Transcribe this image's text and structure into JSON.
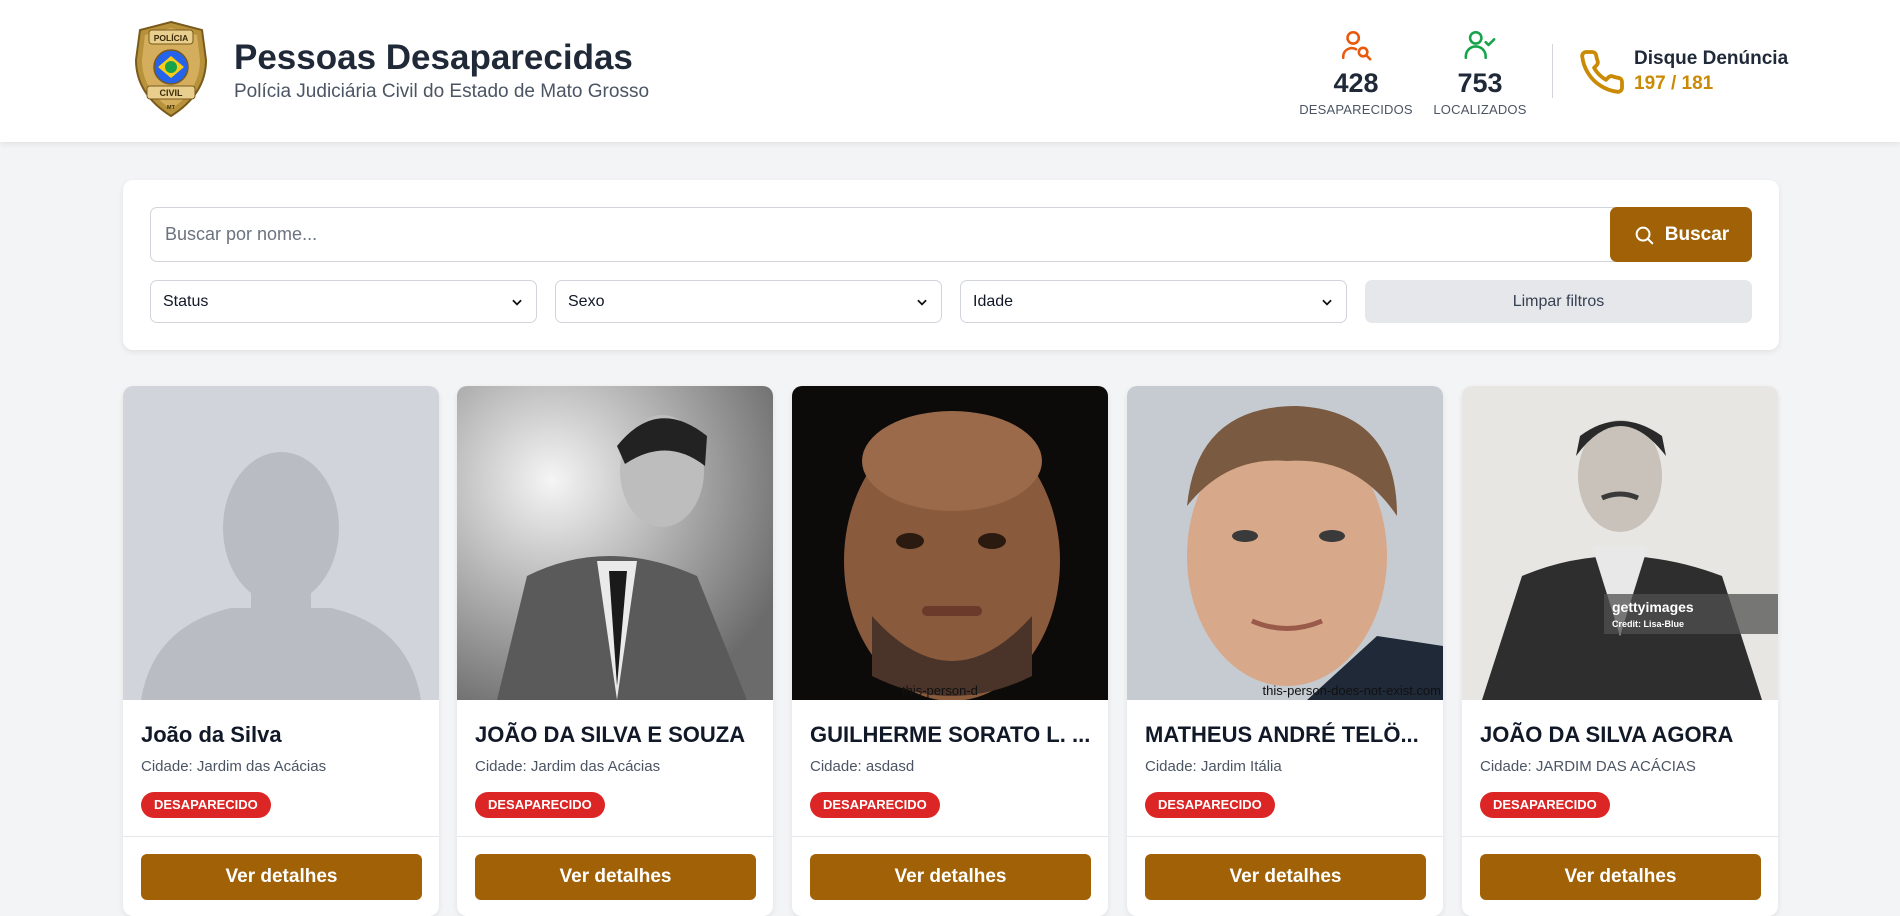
{
  "header": {
    "title": "Pessoas Desaparecidas",
    "subtitle": "Polícia Judiciária Civil do Estado de Mato Grosso",
    "logo": {
      "top_text": "POLÍCIA",
      "bottom_text": "CIVIL",
      "state": "MT"
    },
    "stats": [
      {
        "value": "428",
        "label": "DESAPARECIDOS",
        "icon": "user-search-icon",
        "color": "#ea580c"
      },
      {
        "value": "753",
        "label": "LOCALIZADOS",
        "icon": "user-check-icon",
        "color": "#16a34a"
      }
    ],
    "hotline": {
      "title": "Disque Denúncia",
      "numbers": "197 / 181",
      "icon": "phone-icon",
      "color": "#ca8a04"
    }
  },
  "search": {
    "placeholder": "Buscar por nome...",
    "button_label": "Buscar",
    "filters": {
      "status": "Status",
      "sexo": "Sexo",
      "idade": "Idade"
    },
    "clear_label": "Limpar filtros"
  },
  "cards": [
    {
      "name": "João da Silva",
      "city": "Cidade: Jardim das Acácias",
      "status": "DESAPARECIDO",
      "button": "Ver detalhes",
      "photo": "placeholder-silhouette"
    },
    {
      "name": "JOÃO DA SILVA E SOUZA",
      "city": "Cidade: Jardim das Acácias",
      "status": "DESAPARECIDO",
      "button": "Ver detalhes",
      "photo": "portrait-bw-suit"
    },
    {
      "name": "GUILHERME SORATO L. ...",
      "city": "Cidade: asdasd",
      "status": "DESAPARECIDO",
      "button": "Ver detalhes",
      "photo": "portrait-dark",
      "watermark": "this-person-d"
    },
    {
      "name": "MATHEUS ANDRÉ TELÖ...",
      "city": "Cidade: Jardim Itália",
      "status": "DESAPARECIDO",
      "button": "Ver detalhes",
      "photo": "portrait-light",
      "watermark": "this-person-does-not-exist.com"
    },
    {
      "name": "JOÃO DA SILVA AGORA",
      "city": "Cidade: JARDIM DAS ACÁCIAS",
      "status": "DESAPARECIDO",
      "button": "Ver detalhes",
      "photo": "portrait-vintage",
      "watermark": "gettyimages",
      "watermark_credit": "Credit: Lisa-Blue"
    }
  ],
  "colors": {
    "accent": "#a16207",
    "badge": "#dc2626",
    "background": "#f3f4f6"
  }
}
